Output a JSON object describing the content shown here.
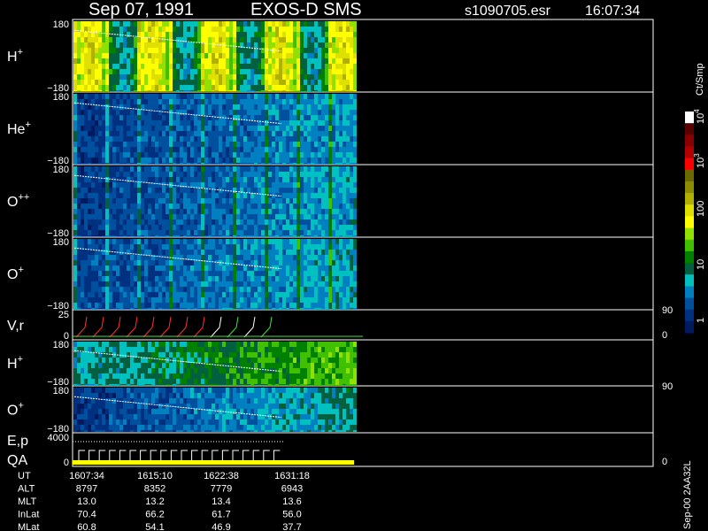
{
  "header": {
    "date": "Sep 07, 1991",
    "mission": "EXOS-D SMS",
    "file": "s1090705.esr",
    "time": "16:07:34"
  },
  "chart_data": {
    "type": "heatmap",
    "panels": [
      {
        "label": "H",
        "superscript": "+",
        "ytop": "180",
        "ybottom": "−180",
        "ylim": [
          -180,
          180
        ]
      },
      {
        "label": "He",
        "superscript": "+",
        "ytop": "180",
        "ybottom": "−180",
        "ylim": [
          -180,
          180
        ]
      },
      {
        "label": "O",
        "superscript": "++",
        "ytop": "180",
        "ybottom": "−180",
        "ylim": [
          -180,
          180
        ]
      },
      {
        "label": "O",
        "superscript": "+",
        "ytop": "180",
        "ybottom": "−180",
        "ylim": [
          -180,
          180
        ]
      },
      {
        "label": "V,r",
        "superscript": "",
        "ytop": "25",
        "ybottom": "0",
        "right_top": "90",
        "right_bottom": "0",
        "ylim": [
          0,
          25
        ]
      },
      {
        "label": "H",
        "superscript": "+",
        "ytop": "180",
        "ybottom": "−180",
        "ylim": [
          -180,
          180
        ]
      },
      {
        "label": "O",
        "superscript": "+",
        "ytop": "180",
        "ybottom": "−180",
        "right_top": "90",
        "ylim": [
          -180,
          180
        ]
      },
      {
        "label": "E,p",
        "label2": "QA",
        "superscript": "",
        "ytop": "4000",
        "ybottom": "0",
        "right_bottom": "0",
        "ylim": [
          0,
          4000
        ]
      }
    ],
    "colorbar": {
      "unit": "Ct/Smp",
      "ticks": [
        "10",
        "10",
        "100",
        "10",
        "1"
      ],
      "tick_sups": [
        "4",
        "3",
        "",
        "",
        ""
      ],
      "tick_values": [
        10000,
        1000,
        100,
        10,
        1
      ],
      "colors": [
        "#ffffff",
        "#5a0000",
        "#8a0000",
        "#b00000",
        "#ff0000",
        "#6a6a00",
        "#8c8c00",
        "#b0b000",
        "#e0e000",
        "#ffff00",
        "#90e000",
        "#40c000",
        "#008000",
        "#006040",
        "#00c0c0",
        "#0080c0",
        "#0050a0",
        "#003080",
        "#001a60"
      ]
    },
    "data_extent_fraction": 0.485,
    "time_axis": {
      "rows": [
        {
          "name": "UT",
          "values": [
            "1607:34",
            "1615:10",
            "1622:38",
            "1631:18"
          ]
        },
        {
          "name": "ALT",
          "values": [
            "8797",
            "8352",
            "7779",
            "6943"
          ]
        },
        {
          "name": "MLT",
          "values": [
            "13.0",
            "13.2",
            "13.4",
            "13.6"
          ]
        },
        {
          "name": "InLat",
          "values": [
            "70.4",
            "66.2",
            "61.7",
            "56.0"
          ]
        },
        {
          "name": "MLat",
          "values": [
            "60.8",
            "54.1",
            "46.9",
            "37.7"
          ]
        }
      ]
    },
    "footer_right": "Sep-00  2AA32L"
  }
}
